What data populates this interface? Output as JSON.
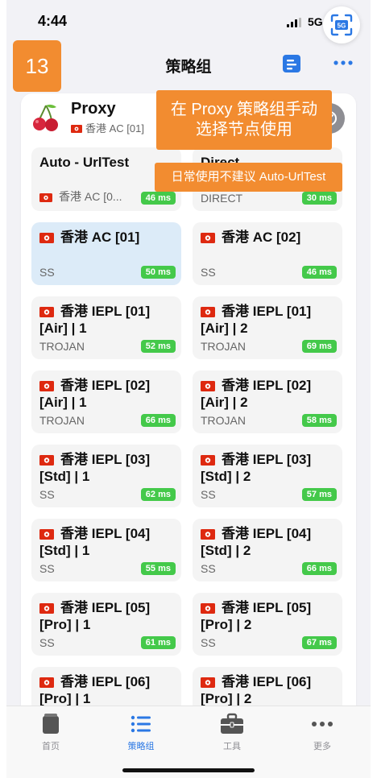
{
  "status_bar": {
    "time": "4:44",
    "network": "5G",
    "scan_badge": "5G"
  },
  "annotation_badge": "13",
  "nav": {
    "title": "策略组"
  },
  "group": {
    "name": "Proxy",
    "current": "香港 AC [01]"
  },
  "callouts": {
    "main": [
      "在 Proxy 策略组手动",
      "选择节点使用"
    ],
    "warning": "日常使用不建议 Auto-UrlTest"
  },
  "tiles": [
    {
      "name": "Auto - UrlTest",
      "proto": "香港 AC [0...",
      "proto_flag": true,
      "latency": "46 ms",
      "selected": false
    },
    {
      "name": "Direct",
      "proto": "DIRECT",
      "proto_flag": false,
      "latency": "30 ms",
      "selected": false
    },
    {
      "name": "香港 AC [01]",
      "flag": true,
      "proto": "SS",
      "latency": "50 ms",
      "selected": true
    },
    {
      "name": "香港 AC [02]",
      "flag": true,
      "proto": "SS",
      "latency": "46 ms",
      "selected": false
    },
    {
      "name": "香港 IEPL [01] [Air] | 1",
      "flag": true,
      "proto": "TROJAN",
      "latency": "52 ms",
      "selected": false
    },
    {
      "name": "香港 IEPL [01] [Air] | 2",
      "flag": true,
      "proto": "TROJAN",
      "latency": "69 ms",
      "selected": false
    },
    {
      "name": "香港 IEPL [02] [Air] | 1",
      "flag": true,
      "proto": "TROJAN",
      "latency": "66 ms",
      "selected": false
    },
    {
      "name": "香港 IEPL [02] [Air] | 2",
      "flag": true,
      "proto": "TROJAN",
      "latency": "58 ms",
      "selected": false
    },
    {
      "name": "香港 IEPL [03] [Std] | 1",
      "flag": true,
      "proto": "SS",
      "latency": "62 ms",
      "selected": false
    },
    {
      "name": "香港 IEPL [03] [Std] | 2",
      "flag": true,
      "proto": "SS",
      "latency": "57 ms",
      "selected": false
    },
    {
      "name": "香港 IEPL [04] [Std] | 1",
      "flag": true,
      "proto": "SS",
      "latency": "55 ms",
      "selected": false
    },
    {
      "name": "香港 IEPL [04] [Std] | 2",
      "flag": true,
      "proto": "SS",
      "latency": "66 ms",
      "selected": false
    },
    {
      "name": "香港 IEPL [05] [Pro] | 1",
      "flag": true,
      "proto": "SS",
      "latency": "61 ms",
      "selected": false
    },
    {
      "name": "香港 IEPL [05] [Pro] | 2",
      "flag": true,
      "proto": "SS",
      "latency": "67 ms",
      "selected": false
    },
    {
      "name": "香港 IEPL [06] [Pro] | 1",
      "flag": true,
      "proto": "SS",
      "latency": "",
      "selected": false
    },
    {
      "name": "香港 IEPL [06] [Pro] | 2",
      "flag": true,
      "proto": "SS",
      "latency": "",
      "selected": false
    }
  ],
  "tabbar": [
    {
      "label": "首页",
      "icon": "home-icon",
      "active": false
    },
    {
      "label": "策略组",
      "icon": "list-icon",
      "active": true
    },
    {
      "label": "工具",
      "icon": "toolbox-icon",
      "active": false
    },
    {
      "label": "更多",
      "icon": "more-icon",
      "active": false
    }
  ],
  "colors": {
    "accent": "#2b78e4",
    "callout": "#f28c30",
    "latency_green": "#44c94a",
    "selected_tile": "#dcebf8",
    "flag_red": "#de2910"
  }
}
